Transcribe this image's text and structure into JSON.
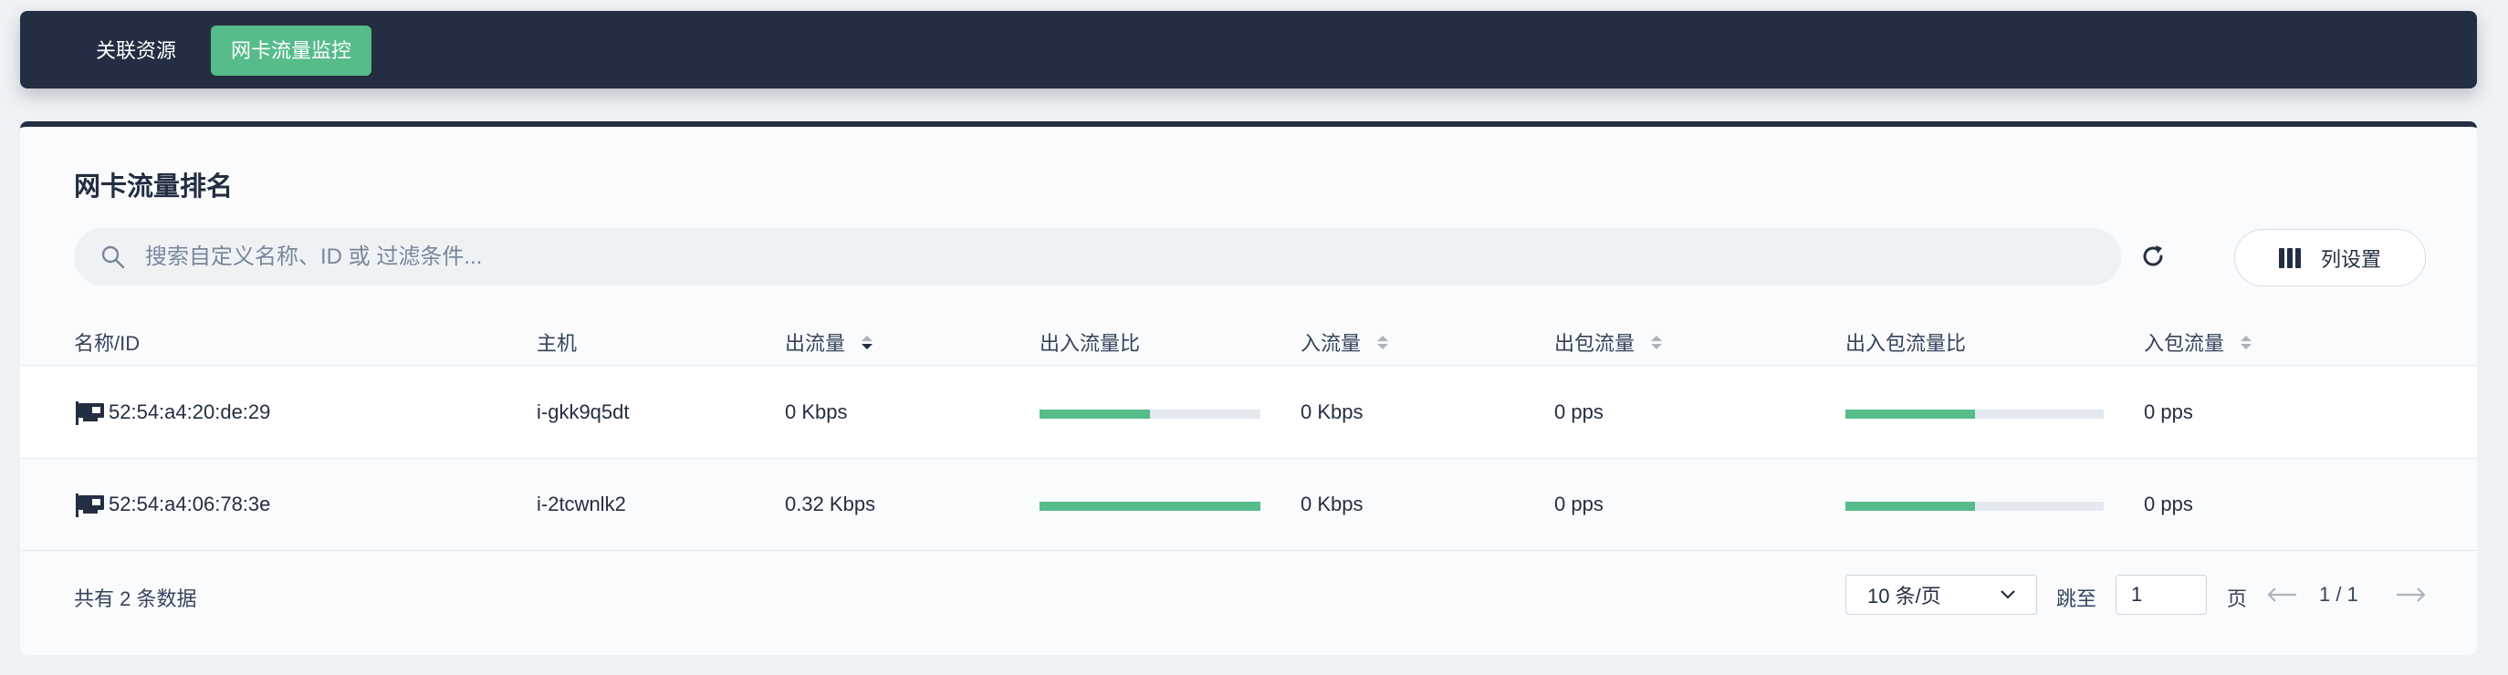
{
  "tabs": [
    {
      "label": "关联资源",
      "active": false
    },
    {
      "label": "网卡流量监控",
      "active": true
    }
  ],
  "card": {
    "title": "网卡流量排名",
    "search_placeholder": "搜索自定义名称、ID 或 过滤条件...",
    "column_settings_label": "列设置"
  },
  "columns": {
    "name": "名称/ID",
    "host": "主机",
    "out_traffic": "出流量",
    "io_ratio": "出入流量比",
    "in_traffic": "入流量",
    "out_packets": "出包流量",
    "packet_ratio": "出入包流量比",
    "in_packets": "入包流量"
  },
  "rows": [
    {
      "mac": "52:54:a4:20:de:29",
      "host": "i-gkk9q5dt",
      "out_traffic": "0 Kbps",
      "io_ratio": 0.5,
      "in_traffic": "0 Kbps",
      "out_packets": "0 pps",
      "packet_ratio": 0.5,
      "in_packets": "0 pps"
    },
    {
      "mac": "52:54:a4:06:78:3e",
      "host": "i-2tcwnlk2",
      "out_traffic": "0.32 Kbps",
      "io_ratio": 1.0,
      "in_traffic": "0 Kbps",
      "out_packets": "0 pps",
      "packet_ratio": 0.5,
      "in_packets": "0 pps"
    }
  ],
  "footer": {
    "total": "共有 2 条数据",
    "page_size": "10 条/页",
    "jump_label": "跳至",
    "jump_value": "1",
    "page_label": "页",
    "page_info": "1 / 1"
  },
  "colors": {
    "nav_bg": "#242e42",
    "accent": "#55bc8a",
    "bar_track": "#e3e9ef"
  },
  "icons": {
    "search": "search-icon",
    "refresh": "refresh-icon",
    "columns": "columns-icon",
    "nic": "network-card-icon",
    "sort": "sort-icon",
    "dropdown": "chevron-down-icon",
    "prev": "arrow-left-icon",
    "next": "arrow-right-icon"
  }
}
